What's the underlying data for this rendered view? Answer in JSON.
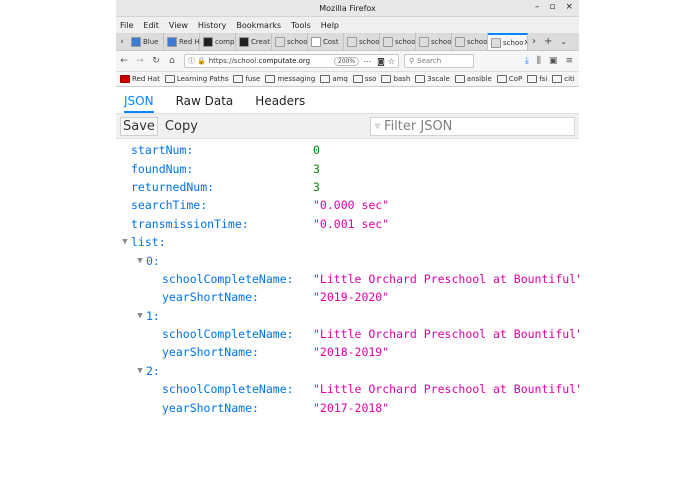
{
  "window": {
    "title": "Mozilla Firefox",
    "controls": [
      "–",
      "▫",
      "×"
    ]
  },
  "menu": [
    "File",
    "Edit",
    "View",
    "History",
    "Bookmarks",
    "Tools",
    "Help"
  ],
  "menu_accel": [
    "F",
    "E",
    "V",
    "s",
    "B",
    "T",
    "H"
  ],
  "tabs": [
    {
      "label": "Blue",
      "color": "#3d7bd6"
    },
    {
      "label": "Red Ha",
      "color": "#3d7bd6"
    },
    {
      "label": "comp",
      "color": "#222222"
    },
    {
      "label": "Creat",
      "color": "#222222"
    },
    {
      "label": "school.c",
      "color": "#dddddd"
    },
    {
      "label": "Cost",
      "color": "#ffffff"
    },
    {
      "label": "school.c",
      "color": "#dddddd"
    },
    {
      "label": "school.c",
      "color": "#dddddd"
    },
    {
      "label": "school.c",
      "color": "#dddddd"
    },
    {
      "label": "school.c",
      "color": "#dddddd"
    },
    {
      "label": "schoo",
      "color": "#dddddd",
      "active": true
    }
  ],
  "nav": {
    "url_prefix": "https://school.",
    "url_host": "computate.org",
    "zoom": "200%",
    "search_placeholder": "Search"
  },
  "bookmarks": [
    "Red Hat",
    "Learning Paths",
    "fuse",
    "messaging",
    "amq",
    "sso",
    "bash",
    "3scale",
    "ansible",
    "CoP",
    "fsi",
    "citi"
  ],
  "viewer": {
    "tabs": [
      "JSON",
      "Raw Data",
      "Headers"
    ],
    "active_tab": "JSON",
    "buttons": {
      "save": "Save",
      "copy": "Copy"
    },
    "filter_placeholder": "Filter JSON"
  },
  "json": {
    "startNum": {
      "key": "startNum:",
      "value": "0"
    },
    "foundNum": {
      "key": "foundNum:",
      "value": "3"
    },
    "returnedNum": {
      "key": "returnedNum:",
      "value": "3"
    },
    "searchTime": {
      "key": "searchTime:",
      "value": "\"0.000 sec\""
    },
    "transmissionTime": {
      "key": "transmissionTime:",
      "value": "\"0.001 sec\""
    },
    "list_key": "list:",
    "list": [
      {
        "index": "0:",
        "name_key": "schoolCompleteName:",
        "name": "\"Little Orchard Preschool at Bountiful\"",
        "year_key": "yearShortName:",
        "year": "\"2019-2020\""
      },
      {
        "index": "1:",
        "name_key": "schoolCompleteName:",
        "name": "\"Little Orchard Preschool at Bountiful\"",
        "year_key": "yearShortName:",
        "year": "\"2018-2019\""
      },
      {
        "index": "2:",
        "name_key": "schoolCompleteName:",
        "name": "\"Little Orchard Preschool at Bountiful\"",
        "year_key": "yearShortName:",
        "year": "\"2017-2018\""
      }
    ]
  },
  "colors": {
    "key": "#0074e8",
    "number": "#058b00",
    "string": "#dd00a9",
    "accent": "#0a84ff"
  }
}
